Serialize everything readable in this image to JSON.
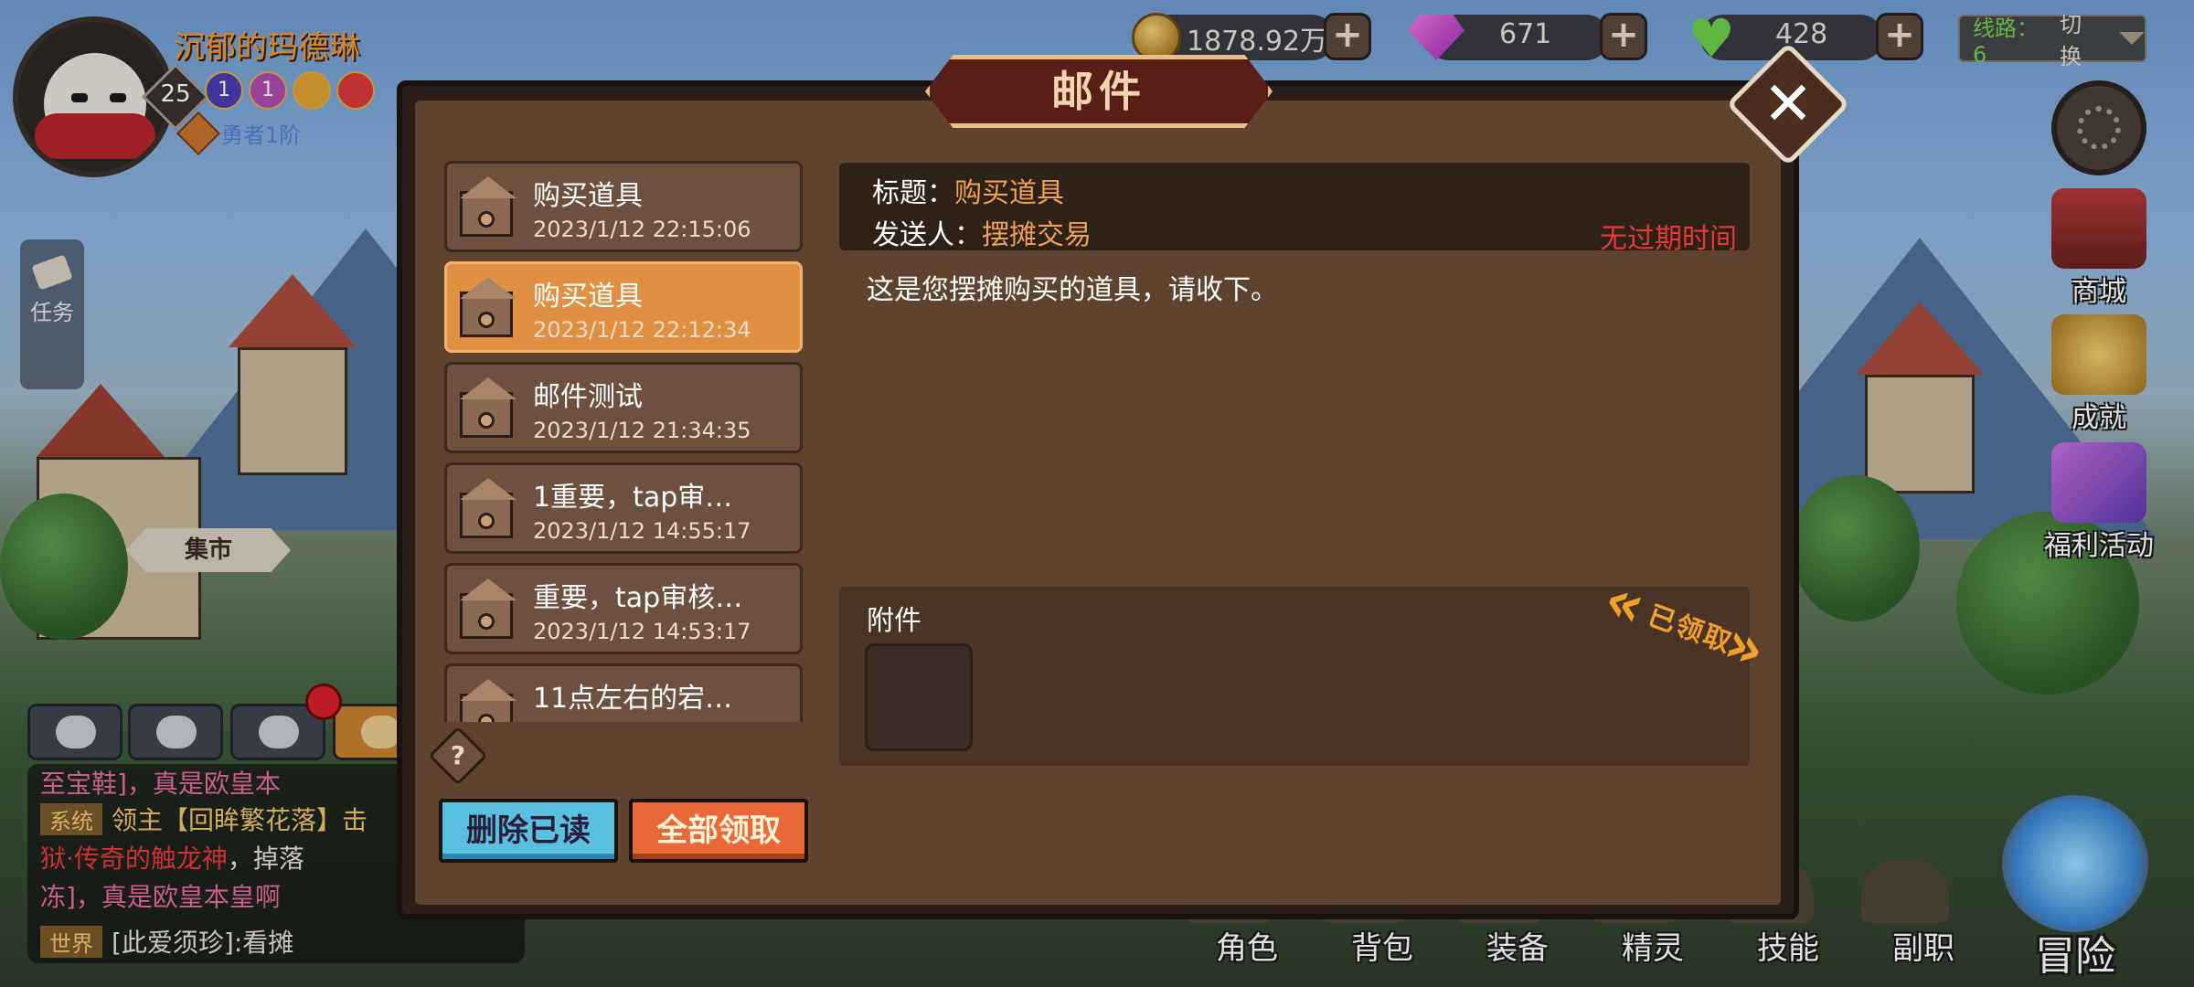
{
  "player": {
    "name": "沉郁的玛德琳",
    "level": "25",
    "rank1": "1",
    "rank2": "1",
    "title": "勇者1阶"
  },
  "resources": {
    "gold": "1878.92万",
    "gems": "671",
    "hearts": "428"
  },
  "route": {
    "label": "线路：6",
    "switch": "切换"
  },
  "side_menu": {
    "shop": "商城",
    "achievement": "成就",
    "welfare": "福利活动"
  },
  "left_widgets": {
    "task": "任务",
    "market": "集市"
  },
  "chat": {
    "line0": "至宝鞋]，真是欧皇本",
    "line1_tag": "系统",
    "line1_text": "领主【回眸繁花落】击",
    "line2_text": "狱·传奇的触龙神",
    "line2_rest": "，掉落",
    "line3_text": "冻]，真是欧皇本皇啊",
    "line4_tag": "世界",
    "line4_text": "[此爱须珍]:看摊"
  },
  "bottom_nav": [
    "角色",
    "背包",
    "装备",
    "精灵",
    "技能",
    "副职"
  ],
  "adventure": "冒险",
  "modal": {
    "title": "邮件",
    "close_icon": "close-icon",
    "help_label": "?",
    "delete_read": "删除已读",
    "claim_all": "全部领取"
  },
  "mails": [
    {
      "title": "购买道具",
      "date": "2023/1/12 22:15:06"
    },
    {
      "title": "购买道具",
      "date": "2023/1/12 22:12:34"
    },
    {
      "title": "邮件测试",
      "date": "2023/1/12 21:34:35"
    },
    {
      "title": "1重要，tap审…",
      "date": "2023/1/12 14:55:17"
    },
    {
      "title": "重要，tap审核…",
      "date": "2023/1/12 14:53:17"
    },
    {
      "title": "11点左右的宕…",
      "date": ""
    }
  ],
  "detail": {
    "subject_label": "标题：",
    "subject_value": "购买道具",
    "sender_label": "发送人：",
    "sender_value": "摆摊交易",
    "expire": "无过期时间",
    "content": "这是您摆摊购买的道具，请收下。",
    "attach_label": "附件",
    "claimed_stamp": "已领取"
  },
  "colors": {
    "accent_orange": "#e09040",
    "expire_red": "#e8383a",
    "route_green": "#6fd04a",
    "panel_brown": "#5e4330"
  }
}
